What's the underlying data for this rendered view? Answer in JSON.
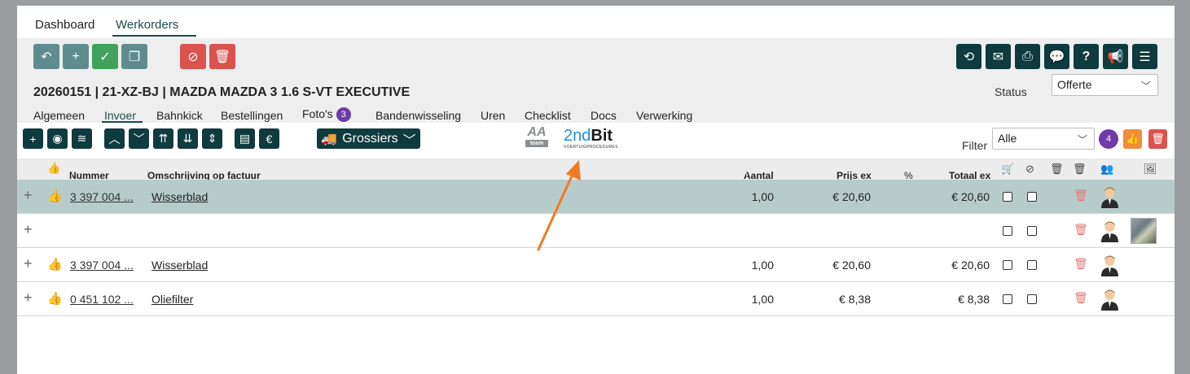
{
  "topnav": {
    "items": [
      "Dashboard",
      "Werkorders"
    ]
  },
  "header": {
    "title": "20260151 | 21-XZ-BJ | MAZDA MAZDA 3 1.6 S-VT EXECUTIVE",
    "status_label": "Status",
    "status_value": "Offerte"
  },
  "tabs": [
    "Algemeen",
    "Invoer",
    "Bahnkick",
    "Bestellingen",
    "Foto's",
    "Bandenwisseling",
    "Uren",
    "Checklist",
    "Docs",
    "Verwerking"
  ],
  "photo_count": "3",
  "toolbar": {
    "grossiers_label": "Grossiers",
    "logo_aa": "AA",
    "logo_aa_sub": "team",
    "logo_2nd_a": "2nd",
    "logo_2nd_b": "Bit",
    "logo_2nd_sub": "VOERTUIGPROCEDURES",
    "filter_label": "Filter",
    "filter_value": "Alle",
    "count": "4"
  },
  "table": {
    "headers": {
      "nummer": "Nummer",
      "omschrijving": "Omschrijving op factuur",
      "aantal": "Aantal",
      "prijs": "Prijs ex",
      "pct": "%",
      "totaal": "Totaal ex"
    },
    "rows": [
      {
        "nummer": "3 397 004 ...",
        "omschrijving": "Wisserblad",
        "aantal": "1,00",
        "prijs": "€ 20,60",
        "totaal": "€ 20,60"
      },
      {
        "nummer": "",
        "omschrijving": "",
        "aantal": "",
        "prijs": "",
        "totaal": ""
      },
      {
        "nummer": "3 397 004 ...",
        "omschrijving": "Wisserblad",
        "aantal": "1,00",
        "prijs": "€ 20,60",
        "totaal": "€ 20,60"
      },
      {
        "nummer": "0 451 102 ...",
        "omschrijving": "Oliefilter",
        "aantal": "1,00",
        "prijs": "€ 8,38",
        "totaal": "€ 8,38"
      }
    ]
  },
  "colors": {
    "dark": "#0e3b3d",
    "grey_btn": "#5f8d8f",
    "green": "#3fa35b",
    "red": "#d9534f",
    "purple": "#6e3ba7",
    "orange": "#f08c3a",
    "arrow": "#f07a22",
    "selected_row": "#b8cbcb"
  }
}
